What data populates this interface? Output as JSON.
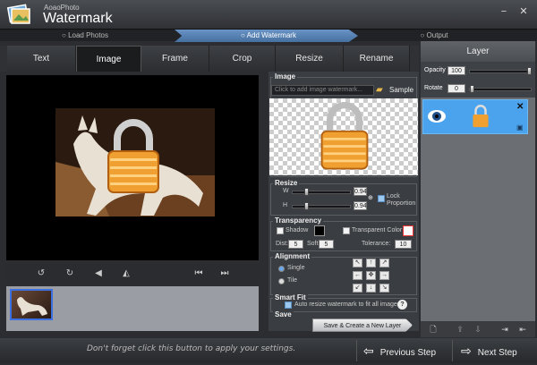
{
  "app": {
    "subtitle": "AoaoPhoto",
    "title": "Watermark",
    "minimize": "−",
    "close": "✕"
  },
  "steps": [
    {
      "label": "Load Photos"
    },
    {
      "label": "Add Watermark"
    },
    {
      "label": "Output"
    }
  ],
  "tabs": [
    {
      "label": "Text"
    },
    {
      "label": "Image"
    },
    {
      "label": "Frame"
    },
    {
      "label": "Crop"
    },
    {
      "label": "Resize"
    },
    {
      "label": "Rename"
    }
  ],
  "image": {
    "header": "Image",
    "placeholder": "Click to add image watermark...",
    "sample": "Sample"
  },
  "resize": {
    "header": "Resize",
    "w_label": "W",
    "w_value": "0.94",
    "h_label": "H",
    "h_value": "0.94",
    "lock": "Lock Proportion",
    "lock_checked": true
  },
  "transparency": {
    "header": "Transparency",
    "shadow": "Shadow",
    "transparent_color": "Transparent Color",
    "dist_label": "Dist:",
    "dist_value": "5",
    "soft_label": "Soft:",
    "soft_value": "5",
    "tolerance_label": "Tolerance:",
    "tolerance_value": "10"
  },
  "alignment": {
    "header": "Alignment",
    "single": "Single",
    "tile": "Tile",
    "selected": "Single",
    "arrows": [
      "↖",
      "↑",
      "↗",
      "←",
      "✥",
      "→",
      "↙",
      "↓",
      "↘"
    ]
  },
  "smart_fit": {
    "header": "Smart Fit",
    "label": "Auto resize watermark to fit all images.",
    "checked": true,
    "help": "?"
  },
  "save": {
    "header": "Save",
    "button": "Save & Create a New Layer"
  },
  "layer": {
    "header": "Layer",
    "opacity_label": "Opacity",
    "opacity_value": "100",
    "rotate_label": "Rotate",
    "rotate_value": "0"
  },
  "hint": "Don't forget click this button to apply your settings.",
  "nav": {
    "prev": "Previous Step",
    "next": "Next Step"
  },
  "colors": {
    "accent": "#4aa3ec",
    "active_step": "#5b86bd",
    "lock": "#f0a030"
  }
}
